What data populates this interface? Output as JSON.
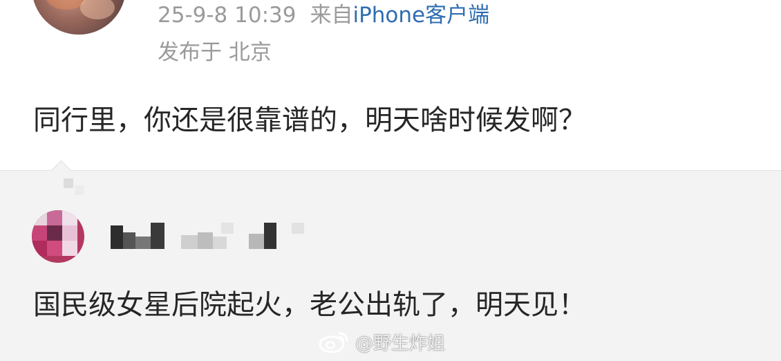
{
  "post": {
    "timestamp": "25-9-8 10:39",
    "source_prefix": "来自",
    "source_device": "iPhone客户端",
    "location": "发布于 北京",
    "text": "同行里，你还是很靠谱的，明天啥时候发啊？"
  },
  "comment": {
    "text": "国民级女星后院起火，老公出轨了，明天见！"
  },
  "watermark": {
    "text": "@野生炸姐",
    "icon": "weibo-icon"
  },
  "colors": {
    "background": "#f3f3f3",
    "card": "#ffffff",
    "meta_gray": "#9a9a9a",
    "link_blue": "#2e6db0",
    "body_text": "#262626"
  }
}
